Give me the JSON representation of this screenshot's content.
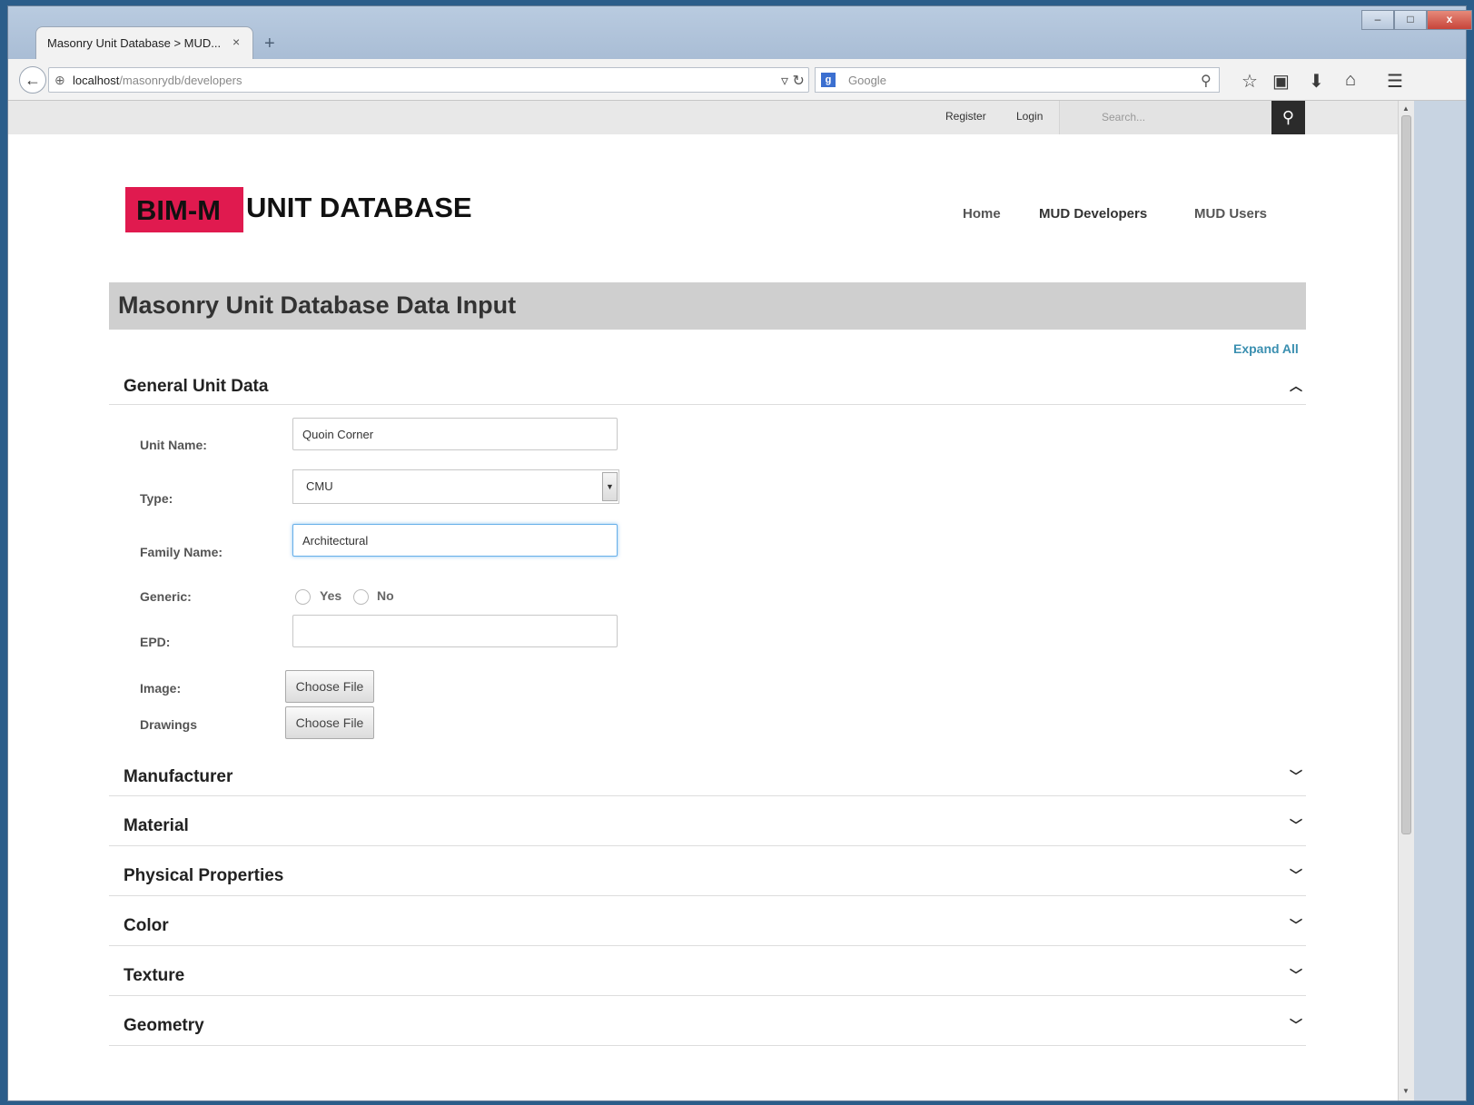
{
  "browser": {
    "tab_title": "Masonry Unit Database > MUD...",
    "tab_close": "×",
    "new_tab": "+",
    "url_host": "localhost",
    "url_path": "/masonrydb/developers",
    "search_engine_placeholder": "Google",
    "window_buttons": [
      "–",
      "□",
      "x"
    ]
  },
  "site": {
    "top_links": {
      "register": "Register",
      "login": "Login"
    },
    "search_placeholder": "Search...",
    "logo_highlight": "BIM-M",
    "logo_text": "UNIT DATABASE",
    "logo_color": "#e01a4f",
    "nav": {
      "home": "Home",
      "developers": "MUD Developers",
      "users": "MUD Users"
    }
  },
  "page": {
    "title": "Masonry Unit Database Data Input",
    "expand_all": "Expand All"
  },
  "general": {
    "title": "General Unit Data",
    "unit_name_label": "Unit Name:",
    "unit_name_value": "Quoin Corner",
    "type_label": "Type:",
    "type_value": "CMU",
    "family_label": "Family Name:",
    "family_value": "Architectural ",
    "generic_label": "Generic:",
    "generic_yes": "Yes",
    "generic_no": "No",
    "epd_label": "EPD:",
    "epd_value": "",
    "image_label": "Image:",
    "drawings_label": "Drawings",
    "choose_file": "Choose File"
  },
  "sections": {
    "manufacturer": "Manufacturer",
    "material": "Material",
    "physical": "Physical Properties",
    "color": "Color",
    "texture": "Texture",
    "geometry": "Geometry"
  },
  "icons": {
    "back": "back-arrow-icon",
    "search": "search-icon",
    "chevron_up": "chevron-up-icon",
    "chevron_down": "chevron-down-icon"
  }
}
